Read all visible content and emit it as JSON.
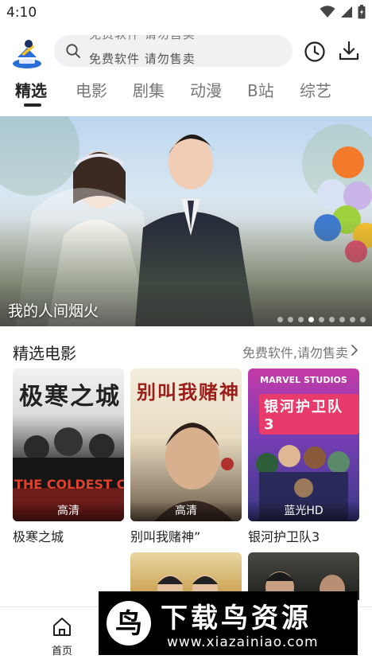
{
  "status_bar": {
    "time": "4:10"
  },
  "header": {
    "search_prev_hint": "免费软件  请勿售卖",
    "search_hint": "免费软件  请勿售卖"
  },
  "tabs": [
    {
      "label": "精选",
      "active": true
    },
    {
      "label": "电影",
      "active": false
    },
    {
      "label": "剧集",
      "active": false
    },
    {
      "label": "动漫",
      "active": false
    },
    {
      "label": "B站",
      "active": false
    },
    {
      "label": "综艺",
      "active": false
    }
  ],
  "banner": {
    "title": "我的人间烟火",
    "dot_count": 9,
    "active_dot": 3
  },
  "section": {
    "title": "精选电影",
    "more_label": "免费软件,请勿售卖"
  },
  "movies": [
    {
      "name": "极寒之城",
      "quality": "高清",
      "poster_text": "极寒之城",
      "poster_sub": "THE COLDEST CI"
    },
    {
      "name": "别叫我赌神”",
      "quality": "高清",
      "poster_text": "别叫我赌神",
      "poster_sub": ""
    },
    {
      "name": "银河护卫队3",
      "quality": "蓝光HD",
      "poster_text": "银河护卫队3",
      "poster_sub": "MARVEL STUDIOS"
    }
  ],
  "bottom_nav": {
    "home_label": "首页"
  },
  "watermark": {
    "title": "下载鸟资源",
    "url": "www.xiazainiao.com",
    "logo_char": "鸟"
  },
  "colors": {
    "accent": "#222222",
    "muted": "#777777",
    "search_bg": "#f1f1f3"
  },
  "icons": [
    "search-icon",
    "clock-icon",
    "download-icon",
    "chevron-right-icon",
    "home-icon",
    "wifi-icon",
    "signal-icon",
    "battery-icon"
  ]
}
